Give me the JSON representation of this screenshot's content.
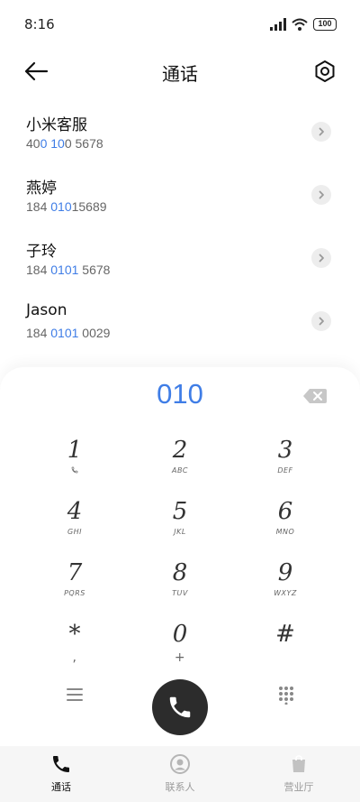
{
  "status_bar": {
    "time": "8:16",
    "battery": "100"
  },
  "header": {
    "title": "通话"
  },
  "results": [
    {
      "name": "小米客服",
      "number_parts": [
        {
          "t": "40",
          "hl": false
        },
        {
          "t": "0",
          "hl": true
        },
        {
          "t": " ",
          "hl": false
        },
        {
          "t": "10",
          "hl": true
        },
        {
          "t": "0 5678",
          "hl": false
        }
      ]
    },
    {
      "name": "燕婷",
      "number_parts": [
        {
          "t": "184 ",
          "hl": false
        },
        {
          "t": "010",
          "hl": true
        },
        {
          "t": "15689",
          "hl": false
        }
      ]
    },
    {
      "name": "子玲",
      "number_parts": [
        {
          "t": "184 ",
          "hl": false
        },
        {
          "t": "0101",
          "hl": true
        },
        {
          "t": " 5678",
          "hl": false
        }
      ]
    },
    {
      "name": "Jason",
      "number_parts": [
        {
          "t": "184 ",
          "hl": false
        },
        {
          "t": "0101",
          "hl": true
        },
        {
          "t": " 0029",
          "hl": false
        }
      ]
    }
  ],
  "dialer": {
    "dialed_number": "010",
    "keys": [
      {
        "digit": "1",
        "letters": ""
      },
      {
        "digit": "2",
        "letters": "ABC"
      },
      {
        "digit": "3",
        "letters": "DEF"
      },
      {
        "digit": "4",
        "letters": "GHI"
      },
      {
        "digit": "5",
        "letters": "JKL"
      },
      {
        "digit": "6",
        "letters": "MNO"
      },
      {
        "digit": "7",
        "letters": "PQRS"
      },
      {
        "digit": "8",
        "letters": "TUV"
      },
      {
        "digit": "9",
        "letters": "WXYZ"
      },
      {
        "digit": "*",
        "letters": ","
      },
      {
        "digit": "0",
        "letters": "+"
      },
      {
        "digit": "#",
        "letters": ""
      }
    ]
  },
  "tabs": {
    "calls": "通话",
    "contacts": "联系人",
    "service_hall": "营业厅"
  },
  "colors": {
    "accent": "#3f7de6",
    "call_button": "#2c2c2c"
  }
}
